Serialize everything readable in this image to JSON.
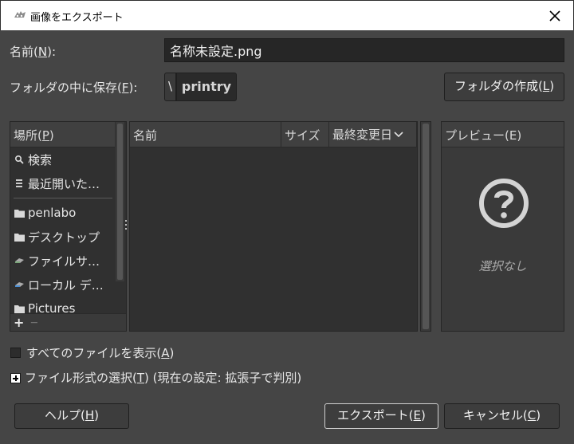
{
  "window": {
    "title": "画像をエクスポート"
  },
  "name_row": {
    "label": "名前",
    "mnemonic": "N",
    "value": "名称未設定.png"
  },
  "folder_row": {
    "label": "フォルダの中に保存",
    "mnemonic": "F",
    "path_separator": "\\",
    "path_button": "printry",
    "create_folder_label": "フォルダの作成",
    "create_folder_mnemonic": "L"
  },
  "places": {
    "header": "場所",
    "header_mnemonic": "P",
    "items": [
      {
        "label": "検索",
        "icon": "search-icon"
      },
      {
        "label": "最近開いた…",
        "icon": "recent-icon"
      },
      {
        "label": "penlabo",
        "icon": "folder-icon"
      },
      {
        "label": "デスクトップ",
        "icon": "folder-icon"
      },
      {
        "label": "ファイルサ…",
        "icon": "filesystem-icon"
      },
      {
        "label": "ローカル デ…",
        "icon": "drive-icon"
      },
      {
        "label": "Pictures",
        "icon": "folder-icon"
      }
    ],
    "add": "+",
    "remove": "—"
  },
  "files": {
    "columns": [
      "名前",
      "サイズ",
      "最終変更日"
    ]
  },
  "preview": {
    "header": "プレビュー(E)",
    "empty_text": "選択なし"
  },
  "show_all": {
    "label": "すべてのファイルを表示",
    "mnemonic": "A",
    "checked": false
  },
  "file_type": {
    "label": "ファイル形式の選択",
    "mnemonic": "T",
    "suffix": " (現在の設定: 拡張子で判別)"
  },
  "buttons": {
    "help": "ヘルプ",
    "help_mnemonic": "H",
    "export": "エクスポート",
    "export_mnemonic": "E",
    "cancel": "キャンセル",
    "cancel_mnemonic": "C"
  },
  "colors": {
    "background": "#454545",
    "panel": "#303030",
    "header": "#404040",
    "text": "#e6e6e6"
  }
}
